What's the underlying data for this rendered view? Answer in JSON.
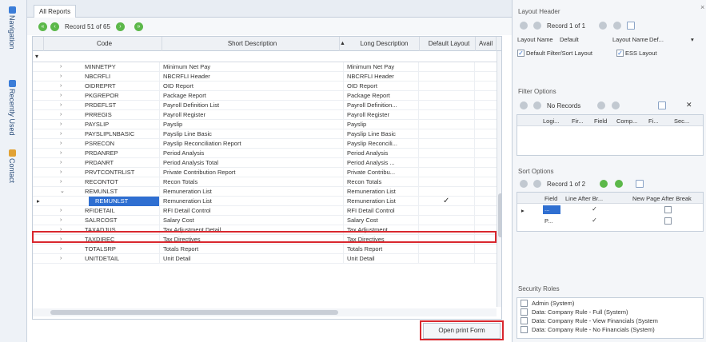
{
  "sidebar": {
    "tabs": [
      {
        "label": "Navigation",
        "icon": "navigation-icon"
      },
      {
        "label": "Recently Used",
        "icon": "recent-icon"
      },
      {
        "label": "Contact",
        "icon": "contact-icon"
      }
    ]
  },
  "tab": {
    "label": "All Reports"
  },
  "close": "×",
  "nav": {
    "record": "Record 51 of 65"
  },
  "grid": {
    "columns": [
      "Code",
      "Short Description",
      "Long Description",
      "Default Layout",
      "Avail"
    ],
    "rows": [
      {
        "code": "MINNETPY",
        "short": "Minimum Net Pay",
        "long": "Minimum Net Pay",
        "exp": "›",
        "def": ""
      },
      {
        "code": "NBCRFLI",
        "short": "NBCRFLI Header",
        "long": "NBCRFLI Header",
        "exp": "›",
        "def": ""
      },
      {
        "code": "OIDREPRT",
        "short": "OID Report",
        "long": "OID Report",
        "exp": "›",
        "def": ""
      },
      {
        "code": "PKGREPOR",
        "short": "Package Report",
        "long": "Package Report",
        "exp": "›",
        "def": ""
      },
      {
        "code": "PRDEFLST",
        "short": "Payroll Definition List",
        "long": "Payroll Definition...",
        "exp": "›",
        "def": ""
      },
      {
        "code": "PRREGIS",
        "short": "Payroll Register",
        "long": "Payroll Register",
        "exp": "›",
        "def": ""
      },
      {
        "code": "PAYSLIP",
        "short": "Payslip",
        "long": "Payslip",
        "exp": "›",
        "def": ""
      },
      {
        "code": "PAYSLIPLNBASIC",
        "short": "Payslip Line Basic",
        "long": "Payslip Line Basic",
        "exp": "›",
        "def": ""
      },
      {
        "code": "PSRECON",
        "short": "Payslip Reconciliation Report",
        "long": "Payslip Reconcili...",
        "exp": "›",
        "def": ""
      },
      {
        "code": "PRDANREP",
        "short": "Period Analysis",
        "long": "Period Analysis",
        "exp": "›",
        "def": ""
      },
      {
        "code": "PRDANRT",
        "short": "Period Analysis Total",
        "long": "Period Analysis ...",
        "exp": "›",
        "def": ""
      },
      {
        "code": "PRVTCONTRLIST",
        "short": "Private Contribution Report",
        "long": "Private Contribu...",
        "exp": "›",
        "def": ""
      },
      {
        "code": "RECONTOT",
        "short": "Recon Totals",
        "long": "Recon Totals",
        "exp": "›",
        "def": ""
      },
      {
        "code": "REMUNLST",
        "short": "Remuneration List",
        "long": "Remuneration List",
        "exp": "⌄",
        "def": ""
      },
      {
        "code": "REMUNLST",
        "short": "Remuneration List",
        "long": "Remuneration List",
        "exp": "",
        "def": "✓"
      },
      {
        "code": "RFIDETAIL",
        "short": "RFI Detail Control",
        "long": "RFI Detail Control",
        "exp": "›",
        "def": ""
      },
      {
        "code": "SALRCOST",
        "short": "Salary Cost",
        "long": "Salary Cost",
        "exp": "›",
        "def": ""
      },
      {
        "code": "TAXADJUS",
        "short": "Tax Adjustment Detail",
        "long": "Tax Adjustment ...",
        "exp": "›",
        "def": ""
      },
      {
        "code": "TAXDIREC",
        "short": "Tax Directives",
        "long": "Tax Directives",
        "exp": "›",
        "def": ""
      },
      {
        "code": "TOTALSRP",
        "short": "Totals Report",
        "long": "Totals Report",
        "exp": "›",
        "def": ""
      },
      {
        "code": "UNITDETAIL",
        "short": "Unit Detail",
        "long": "Unit Detail",
        "exp": "›",
        "def": ""
      }
    ]
  },
  "open_print": "Open print Form",
  "layout_header": {
    "title": "Layout Header",
    "record": "Record 1 of 1",
    "layout_name_label": "Layout Name",
    "layout_name_value": "Default",
    "layout_name2_label": "Layout Name",
    "layout_name2_value": "Def...",
    "default_filter": "Default Filter/Sort Layout",
    "ess_layout": "ESS Layout"
  },
  "filter": {
    "title": "Filter Options",
    "record": "No Records",
    "columns": [
      "Logi...",
      "Fir...",
      "Field",
      "Comp...",
      "Fi...",
      "Sec..."
    ]
  },
  "sort": {
    "title": "Sort Options",
    "record": "Record 1 of 2",
    "columns": [
      "Field",
      "Line After Br...",
      "New Page After Break"
    ],
    "rows": [
      {
        "field": "...",
        "line": "✓"
      },
      {
        "field": "P...",
        "line": "✓"
      }
    ]
  },
  "security": {
    "title": "Security Roles",
    "items": [
      "Admin (System)",
      "Data: Company Rule - Full (System)",
      "Data: Company Rule - View Financials (System",
      "Data: Company Rule - No Financials (System)"
    ]
  }
}
